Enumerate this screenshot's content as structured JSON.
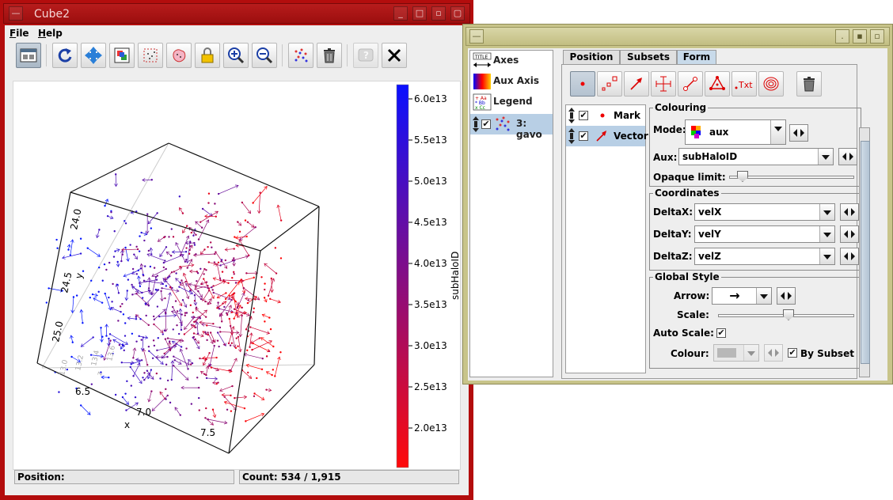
{
  "main_window": {
    "title": "Cube2",
    "menu": [
      "File",
      "Help"
    ],
    "status": {
      "position_label": "Position:",
      "count_label": "Count: 534 / 1,915"
    }
  },
  "plot": {
    "colorbar_label": "subHaloID",
    "colorbar_ticks": [
      "6.0e13",
      "5.5e13",
      "5.0e13",
      "4.5e13",
      "4.0e13",
      "3.5e13",
      "3.0e13",
      "2.5e13",
      "2.0e13"
    ],
    "colorbar_top_color": "#0a10ff",
    "colorbar_bottom_color": "#ff0a0a",
    "x_axis_label": "x",
    "x_ticks": [
      "6.5",
      "7.0",
      "7.5"
    ],
    "y_axis_label": "y",
    "y_ticks": [
      "24.0",
      "24.5",
      "25.0"
    ],
    "z_ticks": [
      "13.0",
      "13.2",
      "13.4",
      "13.6"
    ],
    "z_axis_label": "z"
  },
  "control_window": {
    "layers": [
      {
        "label": "Axes",
        "icon": "axes-icon"
      },
      {
        "label": "Aux Axis",
        "icon": "aux-axis-icon"
      },
      {
        "label": "Legend",
        "icon": "legend-icon"
      },
      {
        "label": "3: gavo",
        "icon": "scatter-layer-icon"
      }
    ],
    "tabs": [
      "Position",
      "Subsets",
      "Form"
    ],
    "active_tab": "Form",
    "forms": [
      {
        "label": "Mark",
        "checked": true
      },
      {
        "label": "Vector",
        "checked": true
      }
    ],
    "colouring": {
      "title": "Colouring",
      "mode_label": "Mode:",
      "mode_value": "aux",
      "aux_label": "Aux:",
      "aux_value": "subHaloID",
      "opaque_label": "Opaque limit:"
    },
    "coordinates": {
      "title": "Coordinates",
      "rows": [
        {
          "label": "DeltaX:",
          "value": "velX"
        },
        {
          "label": "DeltaY:",
          "value": "velY"
        },
        {
          "label": "DeltaZ:",
          "value": "velZ"
        }
      ]
    },
    "global_style": {
      "title": "Global Style",
      "arrow_label": "Arrow:",
      "arrow_value": "→",
      "scale_label": "Scale:",
      "auto_scale_label": "Auto Scale:",
      "auto_scale_checked": true,
      "colour_label": "Colour:",
      "by_subset_label": "By Subset",
      "by_subset_checked": true
    }
  }
}
